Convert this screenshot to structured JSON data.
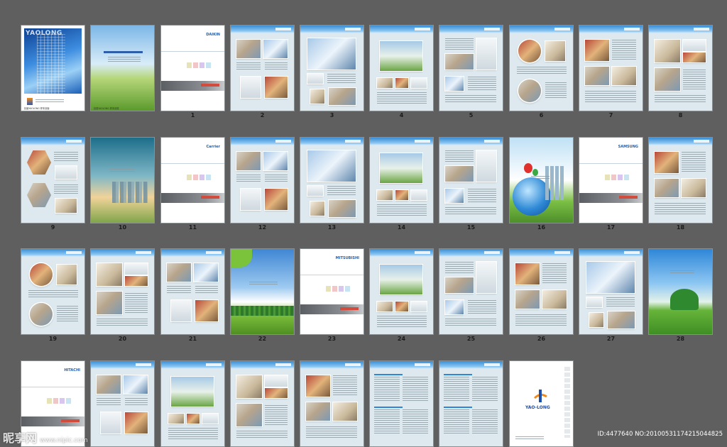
{
  "board": {
    "background": "#5f5f5f",
    "rows": [
      [
        {
          "label": "",
          "kind": "cover-building",
          "caption": "封面YAOLONG 样本封面",
          "logo": "YAOLONG"
        },
        {
          "label": "",
          "kind": "cover-field",
          "caption": "封底YAOLONG 样本封底"
        },
        {
          "label": "1",
          "kind": "brand-divider",
          "logo": "DAIKIN"
        },
        {
          "label": "2",
          "kind": "project-a"
        },
        {
          "label": "3",
          "kind": "project-b"
        },
        {
          "label": "4",
          "kind": "project-c"
        },
        {
          "label": "5",
          "kind": "project-d"
        },
        {
          "label": "6",
          "kind": "project-circles"
        },
        {
          "label": "7",
          "kind": "project-e"
        },
        {
          "label": "8",
          "kind": "project-f"
        }
      ],
      [
        {
          "label": "9",
          "kind": "project-hex"
        },
        {
          "label": "10",
          "kind": "city-cover"
        },
        {
          "label": "11",
          "kind": "brand-divider",
          "logo": "Carrier"
        },
        {
          "label": "12",
          "kind": "project-a"
        },
        {
          "label": "13",
          "kind": "project-b"
        },
        {
          "label": "14",
          "kind": "project-c"
        },
        {
          "label": "15",
          "kind": "project-d"
        },
        {
          "label": "16",
          "kind": "globe-cover"
        },
        {
          "label": "17",
          "kind": "brand-divider",
          "logo": "SAMSUNG"
        },
        {
          "label": "18",
          "kind": "project-e"
        }
      ],
      [
        {
          "label": "19",
          "kind": "project-circles"
        },
        {
          "label": "20",
          "kind": "project-f"
        },
        {
          "label": "21",
          "kind": "project-a"
        },
        {
          "label": "22",
          "kind": "sky-cover"
        },
        {
          "label": "23",
          "kind": "brand-divider",
          "logo": "MITSUBISHI"
        },
        {
          "label": "24",
          "kind": "project-c"
        },
        {
          "label": "25",
          "kind": "project-d"
        },
        {
          "label": "26",
          "kind": "project-e"
        },
        {
          "label": "27",
          "kind": "project-b"
        },
        {
          "label": "28",
          "kind": "park-cover"
        }
      ],
      [
        {
          "label": "",
          "kind": "brand-divider",
          "logo": "HITACHI"
        },
        {
          "label": "",
          "kind": "project-a"
        },
        {
          "label": "",
          "kind": "project-c"
        },
        {
          "label": "",
          "kind": "project-f"
        },
        {
          "label": "",
          "kind": "project-e"
        },
        {
          "label": "",
          "kind": "list"
        },
        {
          "label": "",
          "kind": "list"
        },
        {
          "label": "",
          "kind": "back-logo",
          "logo": "YAO-LONG"
        }
      ]
    ]
  },
  "watermark": {
    "site": "昵享网",
    "domain": "www.nipic.com"
  },
  "image_id": "ID:4477640 NO:20100531174215044825",
  "colors": {
    "accent": "#2f86d6",
    "page_bg": "#dde9ee"
  }
}
